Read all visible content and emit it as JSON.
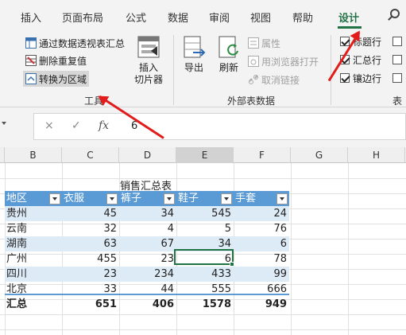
{
  "ribbon_tabs": [
    {
      "label": "插入"
    },
    {
      "label": "页面布局"
    },
    {
      "label": "公式"
    },
    {
      "label": "数据"
    },
    {
      "label": "审阅"
    },
    {
      "label": "视图"
    },
    {
      "label": "帮助"
    },
    {
      "label": "设计",
      "active": true
    }
  ],
  "tools_group": {
    "summarize_pivot": "通过数据透视表汇总",
    "remove_duplicates": "删除重复值",
    "convert_to_range": "转换为区域",
    "insert_slicer": "插入\n切片器",
    "insert_slicer_line1": "插入",
    "insert_slicer_line2": "切片器",
    "group_label": "工具"
  },
  "external_group": {
    "export": "导出",
    "refresh": "刷新",
    "properties": "属性",
    "open_in_browser": "用浏览器打开",
    "unlink": "取消链接",
    "group_label": "外部表数据"
  },
  "style_options_group": {
    "header_row": {
      "label": "标题行",
      "checked": true
    },
    "total_row": {
      "label": "汇总行",
      "checked": true
    },
    "banded_rows": {
      "label": "镶边行",
      "checked": true
    },
    "group_label_partial": "表"
  },
  "formula_bar": {
    "cancel_icon": "×",
    "enter_icon": "✓",
    "fx_icon": "fx",
    "value": "6"
  },
  "columns": [
    "B",
    "C",
    "D",
    "E",
    "F",
    "G",
    "H"
  ],
  "sheet": {
    "title": "销售汇总表",
    "headers": [
      "地区",
      "衣服",
      "裤子",
      "鞋子",
      "手套"
    ],
    "rows": [
      [
        "贵州",
        "45",
        "34",
        "545",
        "24"
      ],
      [
        "云南",
        "32",
        "4",
        "5",
        "76"
      ],
      [
        "湖南",
        "63",
        "67",
        "34",
        "6"
      ],
      [
        "广州",
        "455",
        "23",
        "6",
        "78"
      ],
      [
        "四川",
        "23",
        "234",
        "433",
        "99"
      ],
      [
        "北京",
        "33",
        "44",
        "555",
        "666"
      ]
    ],
    "total": [
      "汇总",
      "651",
      "406",
      "1578",
      "949"
    ]
  },
  "colors": {
    "accent": "#217346",
    "table_header": "#5b9bd5",
    "table_band": "#ddebf7",
    "annotation_arrow": "#e21b1b"
  }
}
